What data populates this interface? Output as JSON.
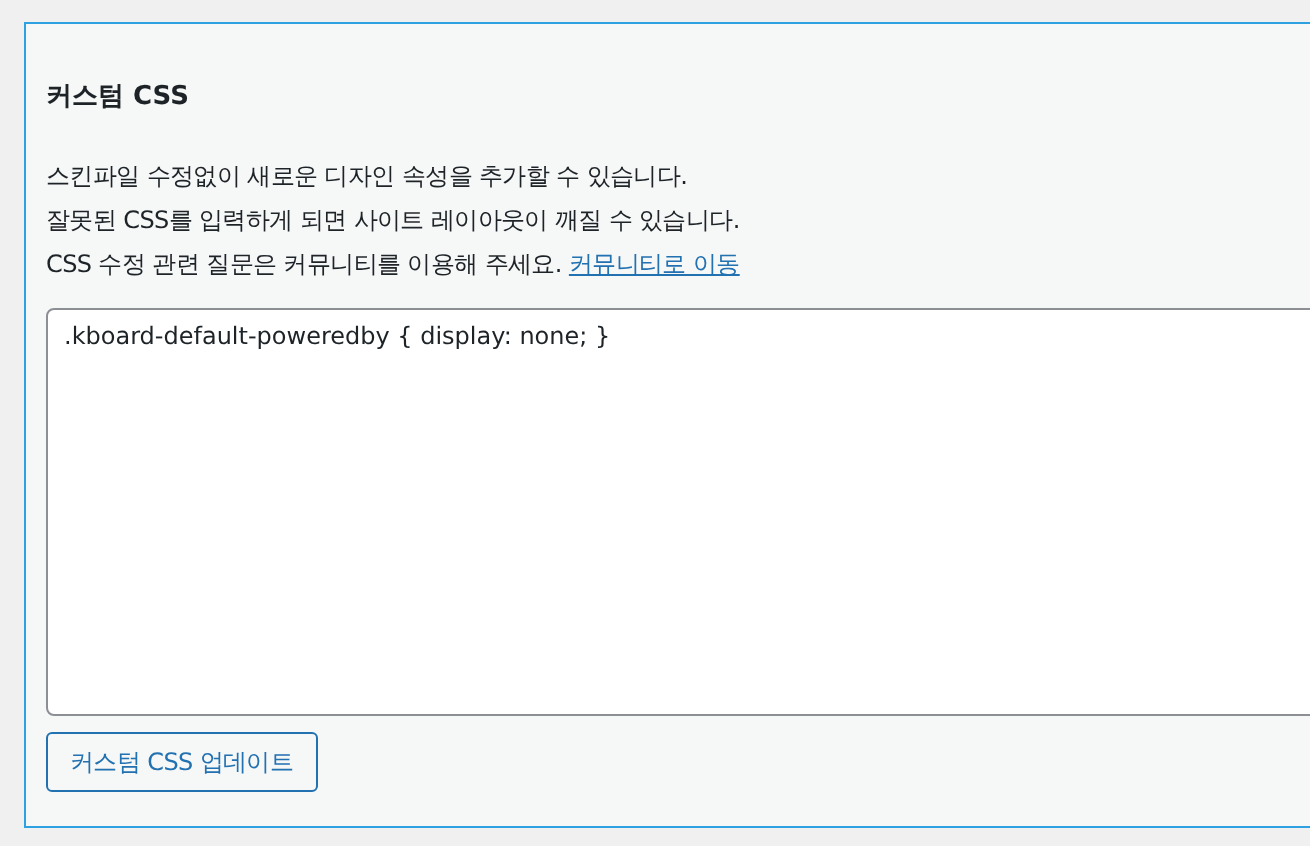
{
  "section": {
    "title": "커스텀 CSS",
    "lines": [
      {
        "text": "스킨파일 수정없이 새로운 디자인 속성을 추가할 수 있습니다."
      },
      {
        "text": "잘못된 CSS를 입력하게 되면 사이트 레이아웃이 깨질 수 있습니다."
      },
      {
        "text": "CSS 수정 관련 질문은 커뮤니티를 이용해 주세요.",
        "link": "커뮤니티로 이동"
      }
    ],
    "editor": {
      "value": ".kboard-default-poweredby { display: none; }"
    },
    "button": "커스텀 CSS 업데이트"
  }
}
